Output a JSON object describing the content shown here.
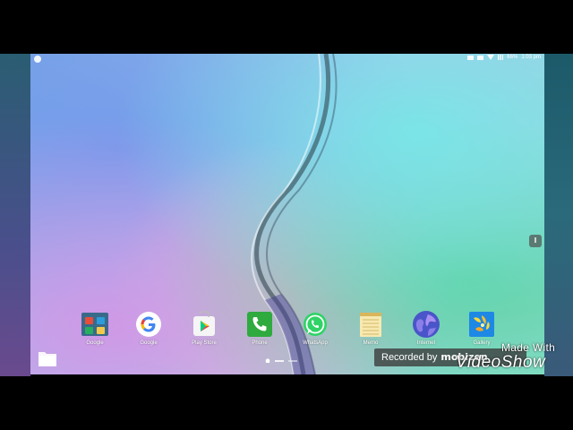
{
  "status_bar": {
    "battery": "66%",
    "time": "1:03 pm"
  },
  "dock": {
    "apps": [
      {
        "label": "Google",
        "icon": "google-folder-icon"
      },
      {
        "label": "Google",
        "icon": "google-g-icon"
      },
      {
        "label": "Play Store",
        "icon": "play-store-icon"
      },
      {
        "label": "Phone",
        "icon": "phone-icon"
      },
      {
        "label": "WhatsApp",
        "icon": "whatsapp-icon"
      },
      {
        "label": "Memo",
        "icon": "memo-icon"
      },
      {
        "label": "Internet",
        "icon": "internet-icon"
      },
      {
        "label": "Gallery",
        "icon": "gallery-icon"
      }
    ]
  },
  "overlay": {
    "recorded_by": "Recorded by",
    "recorder_brand": "mobizen",
    "watermark_line1": "Made With",
    "watermark_line2": "VideoShow"
  }
}
